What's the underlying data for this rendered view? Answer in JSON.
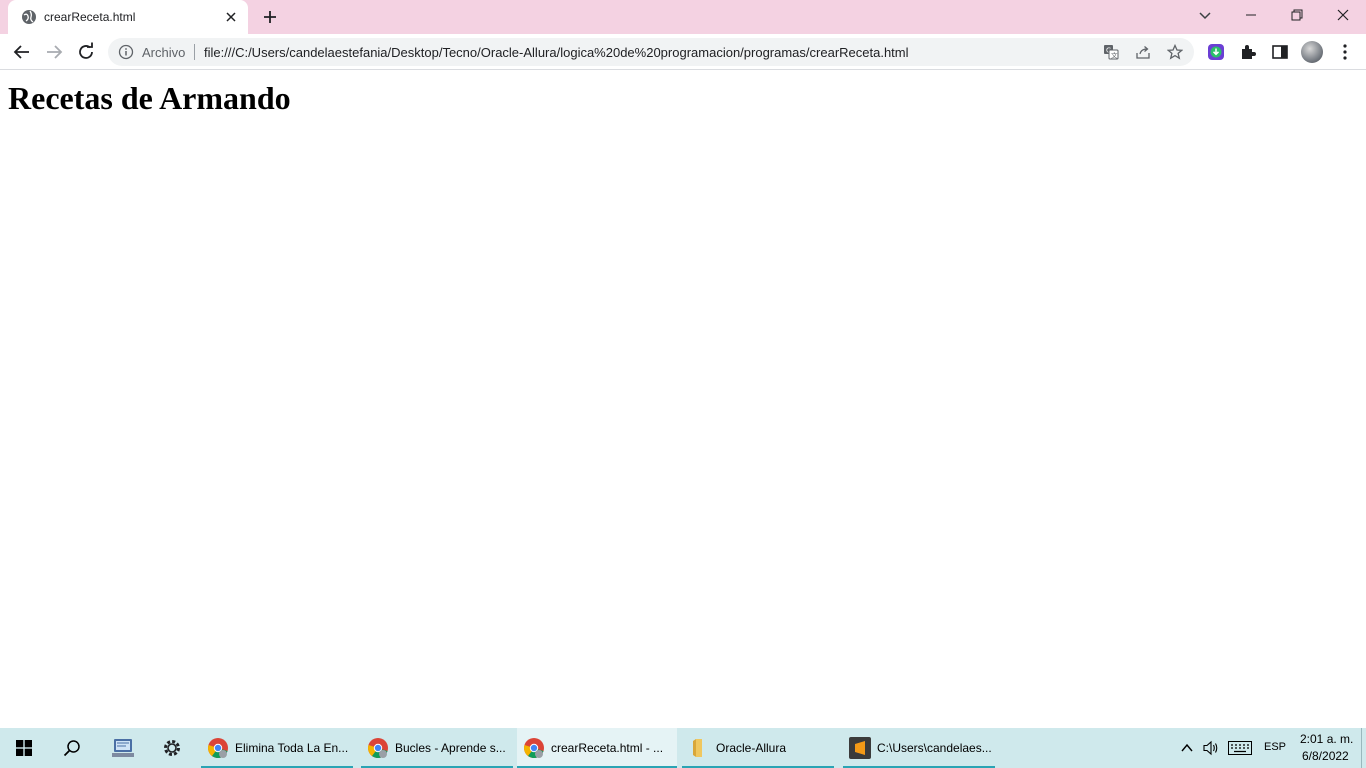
{
  "browser": {
    "tab": {
      "title": "crearReceta.html",
      "favicon": "globe-icon",
      "close_icon": "close-icon"
    },
    "new_tab_icon": "plus-icon",
    "tab_search_icon": "chevron-down-icon",
    "window_controls": [
      "minimize-icon",
      "restore-icon",
      "close-icon"
    ],
    "toolbar": {
      "back_icon": "arrow-left-icon",
      "forward_icon": "arrow-right-icon",
      "reload_icon": "reload-icon",
      "omnibox": {
        "info_icon": "info-icon",
        "scheme_label": "Archivo",
        "url": "file:///C:/Users/candelaestefania/Desktop/Tecno/Oracle-Allura/logica%20de%20programacion/programas/crearReceta.html",
        "icons": [
          "translate-icon",
          "share-icon",
          "star-icon"
        ]
      },
      "extensions": [
        "extension-download-icon",
        "puzzle-icon",
        "side-panel-icon"
      ],
      "profile_icon": "avatar-icon",
      "menu_icon": "kebab-menu-icon"
    }
  },
  "page": {
    "heading": "Recetas de Armando"
  },
  "taskbar": {
    "start_icon": "windows-logo-icon",
    "search_icon": "search-icon",
    "pinned": [
      "network-computer-icon",
      "settings-gear-icon"
    ],
    "apps": [
      {
        "label": "Elimina Toda La En...",
        "icon": "chrome-icon",
        "active": false
      },
      {
        "label": "Bucles - Aprende s...",
        "icon": "chrome-icon",
        "active": false
      },
      {
        "label": "crearReceta.html - ...",
        "icon": "chrome-icon",
        "active": true
      },
      {
        "label": "Oracle-Allura",
        "icon": "folder-icon",
        "active": false
      },
      {
        "label": "C:\\Users\\candelaes...",
        "icon": "sublime-text-icon",
        "active": false
      }
    ],
    "tray": {
      "chevron_icon": "chevron-up-icon",
      "volume_icon": "volume-icon",
      "keyboard_icon": "keyboard-icon",
      "language": "ESP",
      "time": "2:01 a. m.",
      "date": "6/8/2022"
    }
  },
  "colors": {
    "tabstrip_bg": "#f4d2e2",
    "taskbar_bg": "#cfe9ec",
    "taskbar_accent": "#2aa4b4",
    "omnibox_bg": "#f1f3f4"
  }
}
